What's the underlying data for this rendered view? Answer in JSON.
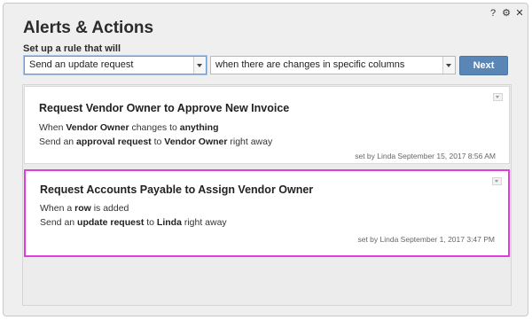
{
  "dialog": {
    "title": "Alerts & Actions",
    "controls": {
      "help": "?",
      "settings": "⚙",
      "close": "✕"
    }
  },
  "setup": {
    "label": "Set up a rule that will",
    "action_select": "Send an update request",
    "trigger_select": "when there are changes in specific columns",
    "next_label": "Next"
  },
  "rules": [
    {
      "title": "Request Vendor Owner to Approve New Invoice",
      "line1": {
        "a": "When ",
        "b": "Vendor Owner",
        "c": " changes to ",
        "d": "anything"
      },
      "line2": {
        "a": "Send an ",
        "b": "approval request",
        "c": " to ",
        "d": "Vendor Owner",
        "e": " right away"
      },
      "meta": "set by Linda  September 15, 2017 8:56 AM"
    },
    {
      "title": "Request Accounts Payable to Assign Vendor Owner",
      "line1": {
        "a": "When a ",
        "b": "row",
        "c": " is added"
      },
      "line2": {
        "a": "Send an ",
        "b": "update request",
        "c": " to ",
        "d": "Linda",
        "e": " right away"
      },
      "meta": "set by Linda  September 1, 2017 3:47 PM"
    }
  ],
  "colors": {
    "accent": "#5a86b6",
    "selection": "#e23be0"
  }
}
